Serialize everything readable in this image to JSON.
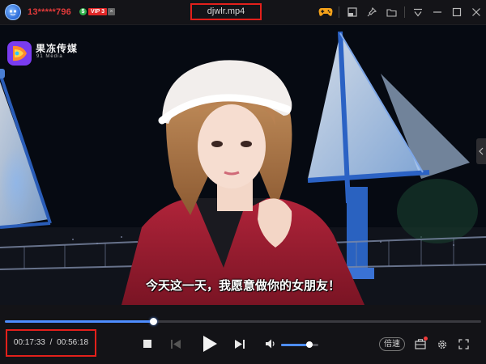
{
  "titlebar": {
    "user_id": "13*****796",
    "vip_coin": "$",
    "vip_badge": "VIP 3",
    "vip_close": "×",
    "file_name": "djwlr.mp4",
    "icons": [
      "game-controller-icon",
      "mini-mode-icon",
      "pin-icon",
      "folder-icon",
      "menu-icon",
      "minimize-icon",
      "maximize-icon",
      "close-icon"
    ]
  },
  "watermark": {
    "brand": "果冻传媒",
    "brand_sub": "91 Media"
  },
  "video": {
    "subtitle": "今天这一天，我愿意做你的女朋友！"
  },
  "player": {
    "current_time": "00:17:33",
    "time_separator": "/",
    "total_time": "00:56:18",
    "progress": 0.312,
    "volume": 0.75,
    "speed_label": "倍速",
    "accent_color": "#4e8dff",
    "highlight_color": "#e3201b"
  }
}
